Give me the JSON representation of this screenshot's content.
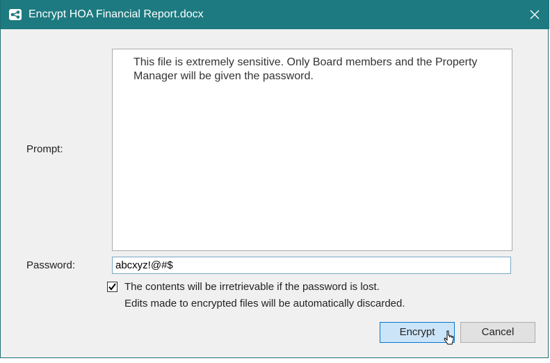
{
  "window": {
    "title": "Encrypt HOA Financial Report.docx",
    "close_glyph": "✕",
    "icon": "app-icon",
    "accent_color": "#1d7a80"
  },
  "form": {
    "prompt_label": "Prompt:",
    "prompt_text": "This file is extremely sensitive. Only Board members and the Property Manager will be given the password.",
    "password_label": "Password:",
    "password_value": "abcxyz!@#$",
    "checkbox_checked": true,
    "checkbox_line1": "The contents will be irretrievable if the password is lost.",
    "checkbox_line2": "Edits made to encrypted files will be automatically discarded."
  },
  "buttons": {
    "encrypt_label": "Encrypt",
    "cancel_label": "Cancel"
  }
}
